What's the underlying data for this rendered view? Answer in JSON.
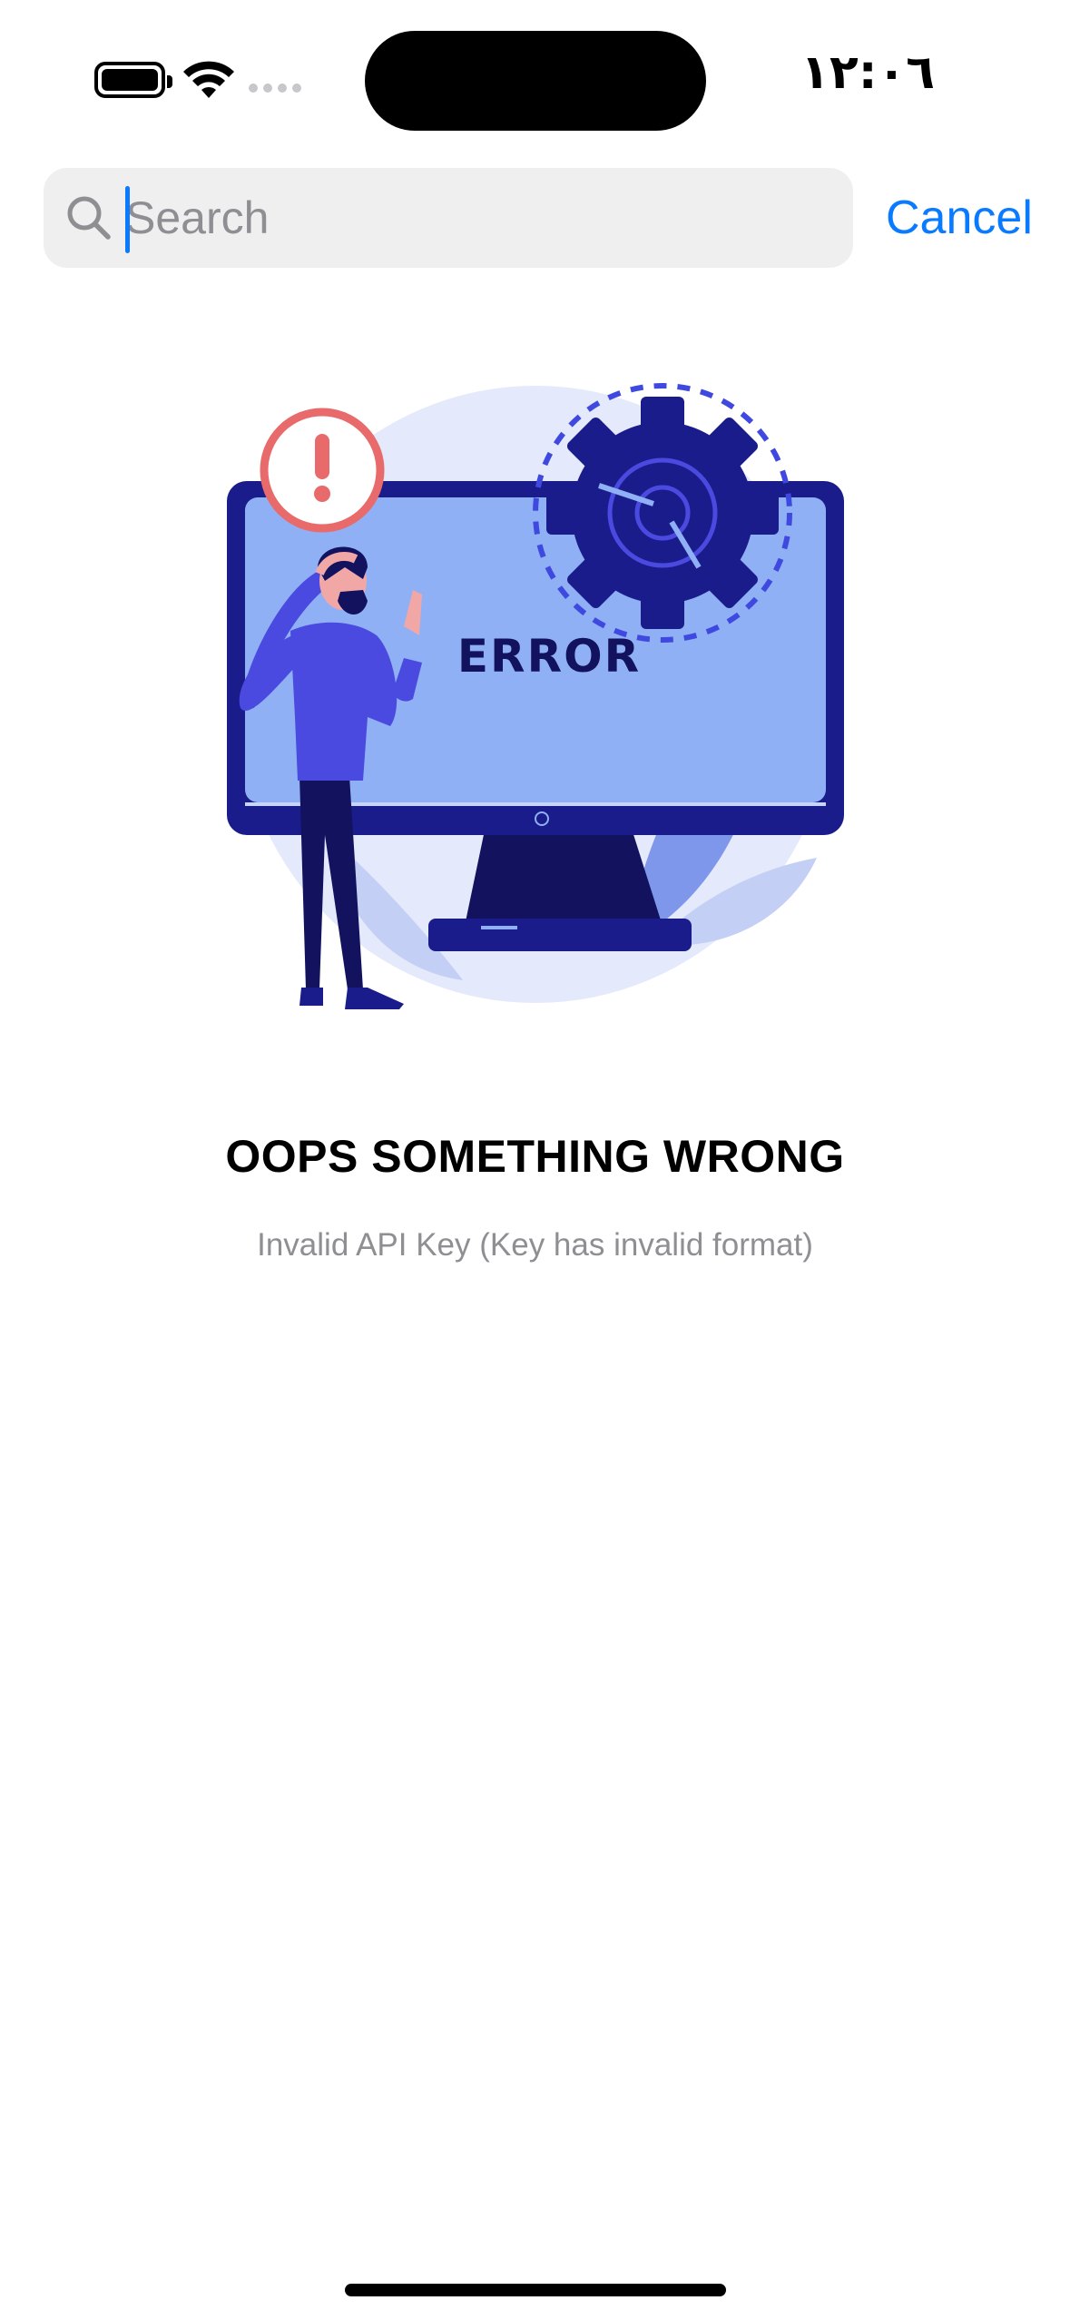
{
  "status_bar": {
    "time": "١٢:٠٦",
    "icons": [
      "battery-icon",
      "wifi-icon",
      "signal-icon"
    ]
  },
  "search": {
    "placeholder": "Search",
    "value": "",
    "cancel_label": "Cancel"
  },
  "error": {
    "illustration_text": "ERROR",
    "title": "OOPS SOMETHING WRONG",
    "message": "Invalid API Key (Key has invalid format)"
  },
  "colors": {
    "accent": "#0a7aff",
    "illustration_dark": "#1b1c8c",
    "illustration_screen": "#8fb0f5",
    "illustration_figure": "#4a4ae0",
    "alert_red": "#e86a6a"
  }
}
